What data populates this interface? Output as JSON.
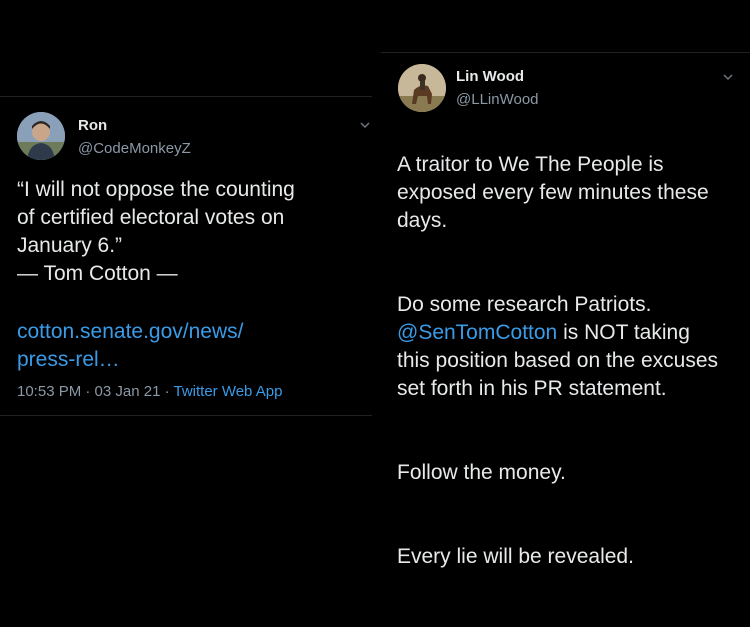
{
  "left_tweet": {
    "name": "Ron",
    "handle": "@CodeMonkeyZ",
    "text": "“I will not oppose the counting\nof certified electoral votes on\nJanuary 6.”\n— Tom Cotton —",
    "link": "cotton.senate.gov/news/\npress-rel…",
    "time": "10:53 PM · 03 Jan 21 · ",
    "app": "Twitter Web App",
    "avatar_icon": "profile-photo",
    "chevron_icon": "chevron-down"
  },
  "right_tweet": {
    "name": "Lin Wood",
    "handle": "@LLinWood",
    "para1": "A traitor to We The People is\nexposed every few minutes these\ndays.",
    "para2_mention": "@SenTomCotton",
    "para2_rest": " is NOT taking\nthis position based on the excuses\nset forth in his PR statement.",
    "para2_intro": "Do some research Patriots.\n",
    "para3": "Follow the money.",
    "para4": "Every lie will be revealed.",
    "avatar_icon": "profile-photo",
    "chevron_icon": "chevron-down"
  },
  "colors": {
    "background": "#000000",
    "text": "#e7e9ea",
    "secondary": "#8b98a5",
    "link": "#3a9be7"
  }
}
